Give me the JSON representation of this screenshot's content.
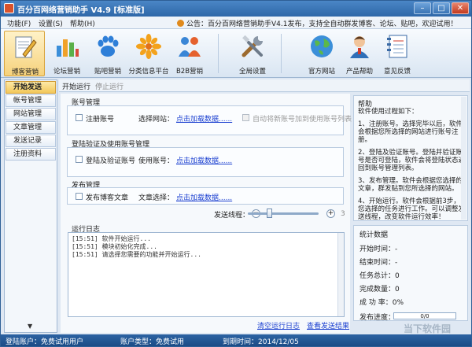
{
  "window": {
    "title": "百分百网络营销助手 V4.9 [标准版]",
    "buttons": [
      "–",
      "□",
      "✕"
    ]
  },
  "menu": {
    "items": [
      "功能(F)",
      "设置(S)",
      "帮助(H)"
    ],
    "notice": "公告：百分百网络营销助手V4.1发布，支持全自动群发博客、论坛、贴吧，欢迎试用！"
  },
  "toolbar": {
    "items": [
      {
        "label": "博客营销",
        "icon": "blog-notepad-icon"
      },
      {
        "label": "论坛营销",
        "icon": "forum-barchart-icon"
      },
      {
        "label": "贴吧营销",
        "icon": "tieba-paw-icon"
      },
      {
        "label": "分类信息平台",
        "icon": "classified-flower-icon"
      },
      {
        "label": "B2B营销",
        "icon": "b2b-people-icon"
      },
      {
        "label": "全局设置",
        "icon": "settings-tools-icon"
      },
      {
        "label": "官方网站",
        "icon": "globe-icon"
      },
      {
        "label": "产品帮助",
        "icon": "helper-person-icon"
      },
      {
        "label": "意见反馈",
        "icon": "feedback-notebook-icon"
      }
    ]
  },
  "sidebar": {
    "items": [
      "开始发送",
      "帐号管理",
      "网站管理",
      "文章管理",
      "发送记录",
      "注册资料"
    ],
    "scroll_icon": "chevron-down-icon"
  },
  "tabs": {
    "start": "开始运行",
    "stop": "停止运行"
  },
  "account": {
    "title": "账号管理",
    "register_label": "注册账号",
    "site_label": "选择网站：",
    "load_link": "点击加载数据......",
    "auto_add_label": "自动将新账号加到使用账号列表"
  },
  "verify": {
    "title": "登陆验证及使用账号管理",
    "login_label": "登陆及验证账号",
    "use_label": "使用账号：",
    "load_link": "点击加载数据......"
  },
  "publish": {
    "title": "发布管理",
    "post_label": "发布博客文章",
    "article_label": "文章选择：",
    "load_link": "点击加载数据......",
    "threads_label": "发送线程：",
    "minus": "−",
    "plus": "+",
    "threads_value": "3",
    "threads_fraction": 0.3
  },
  "log": {
    "title": "运行日志",
    "lines": [
      "[15:51] 软件开始运行...",
      "[15:51] 模块初始化完成...",
      "[15:51] 请选择您需要的功能并开始运行..."
    ],
    "clear_link": "清空运行日志",
    "view_link": "查看发送结果"
  },
  "help": {
    "title": "帮助",
    "paragraphs": [
      "软件使用过程如下：",
      "1、注册账号。选择完毕以后，软件会根据您所选择的网站进行账号注册。",
      "2、登陆及验证账号。登陆并验证账号是否可登陆，软件会将登陆状态返回到账号管理列表。",
      "3、发布管理。软件会根据您选择的文章，群发贴到您所选择的网站。",
      "4、开始运行。软件会根据前3步，您选择的任务进行工作。可以调整发送线程，改变软件运行效率！"
    ]
  },
  "stats": {
    "title": "统计数据",
    "rows": [
      {
        "label": "开始时间：",
        "value": "-"
      },
      {
        "label": "结束时间：",
        "value": "-"
      },
      {
        "label": "任务总计：",
        "value": "0"
      },
      {
        "label": "完成数量：",
        "value": "0"
      },
      {
        "label": "成 功 率：",
        "value": "0%"
      }
    ],
    "progress_label": "发布进度：",
    "progress_text": "0/0",
    "progress_fraction": 0
  },
  "status": {
    "login_user_label": "登陆账户：",
    "login_user_value": "免费试用用户",
    "account_type_label": "账户类型：",
    "account_type_value": "免费试用",
    "expire_label": "到期时间：",
    "expire_value": "2014/12/05"
  },
  "watermark": "当下软件园",
  "colors": {
    "title_bar": "#2e67a8",
    "active_tab": "#f3c85a",
    "link": "#1a3fd0"
  }
}
